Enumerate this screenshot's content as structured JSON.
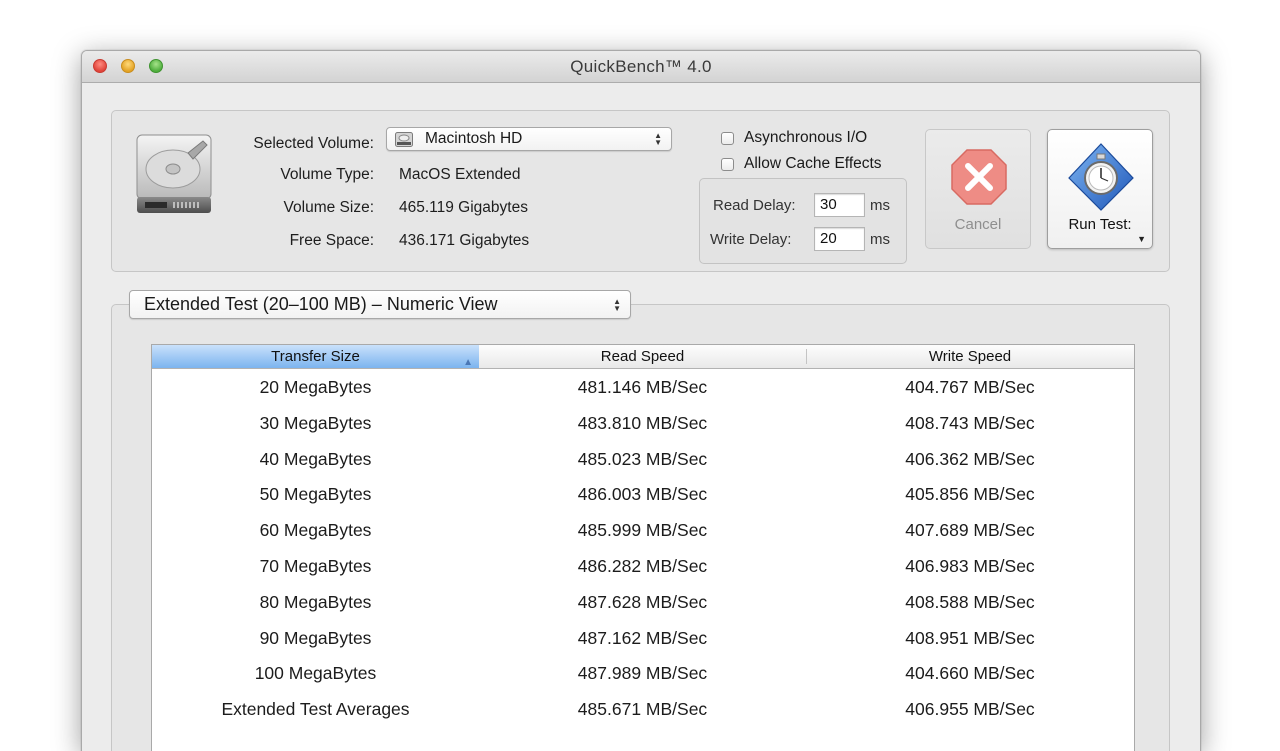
{
  "window": {
    "title": "QuickBench™ 4.0"
  },
  "volume": {
    "selected_label": "Selected Volume:",
    "selected_value": "Macintosh HD",
    "type_label": "Volume Type:",
    "type_value": "MacOS Extended",
    "size_label": "Volume Size:",
    "size_value": "465.119 Gigabytes",
    "free_label": "Free Space:",
    "free_value": "436.171 Gigabytes"
  },
  "options": {
    "async_io_label": "Asynchronous I/O",
    "async_io_checked": false,
    "cache_label": "Allow Cache Effects",
    "cache_checked": false,
    "read_delay_label": "Read Delay:",
    "read_delay_value": "30",
    "write_delay_label": "Write Delay:",
    "write_delay_value": "20",
    "unit": "ms"
  },
  "buttons": {
    "cancel_label": "Cancel",
    "run_label": "Run Test:"
  },
  "test_mode": {
    "selected": "Extended Test (20–100 MB) – Numeric View"
  },
  "table": {
    "columns": [
      "Transfer Size",
      "Read Speed",
      "Write Speed"
    ],
    "sort_column": "Transfer Size",
    "rows": [
      {
        "size": "20 MegaBytes",
        "read": "481.146 MB/Sec",
        "write": "404.767 MB/Sec"
      },
      {
        "size": "30 MegaBytes",
        "read": "483.810 MB/Sec",
        "write": "408.743 MB/Sec"
      },
      {
        "size": "40 MegaBytes",
        "read": "485.023 MB/Sec",
        "write": "406.362 MB/Sec"
      },
      {
        "size": "50 MegaBytes",
        "read": "486.003 MB/Sec",
        "write": "405.856 MB/Sec"
      },
      {
        "size": "60 MegaBytes",
        "read": "485.999 MB/Sec",
        "write": "407.689 MB/Sec"
      },
      {
        "size": "70 MegaBytes",
        "read": "486.282 MB/Sec",
        "write": "406.983 MB/Sec"
      },
      {
        "size": "80 MegaBytes",
        "read": "487.628 MB/Sec",
        "write": "408.588 MB/Sec"
      },
      {
        "size": "90 MegaBytes",
        "read": "487.162 MB/Sec",
        "write": "408.951 MB/Sec"
      },
      {
        "size": "100 MegaBytes",
        "read": "487.989 MB/Sec",
        "write": "404.660 MB/Sec"
      },
      {
        "size": "Extended Test Averages",
        "read": "485.671 MB/Sec",
        "write": "406.955 MB/Sec"
      }
    ]
  },
  "colors": {
    "sorted_header": "#7cb4ef",
    "cancel_red": "#e9524a",
    "run_icon_blue": "#2f6fd0"
  },
  "icons": [
    "hard-drive-icon",
    "small-drive-icon",
    "cancel-x-icon",
    "stopwatch-icon",
    "sort-ascending-icon"
  ]
}
